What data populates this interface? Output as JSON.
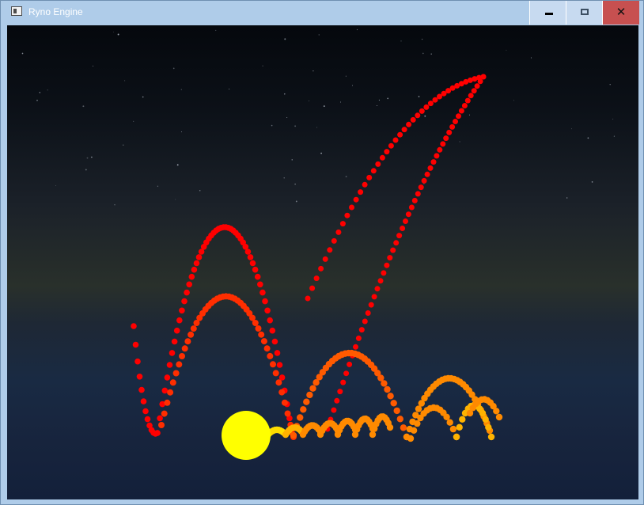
{
  "window": {
    "title": "Ryno Engine",
    "controls": {
      "minimize": "–",
      "maximize": "□",
      "close": "✕"
    }
  },
  "scene": {
    "colors": {
      "sky_top": "#05080d",
      "horizon": "#29302b",
      "water": "#17243d",
      "sun": "#ffff00"
    },
    "trail_colors": [
      "#ff0000",
      "#ff2e00",
      "#ff5a00",
      "#ff8a00",
      "#ffb300",
      "#ffdd00"
    ]
  }
}
